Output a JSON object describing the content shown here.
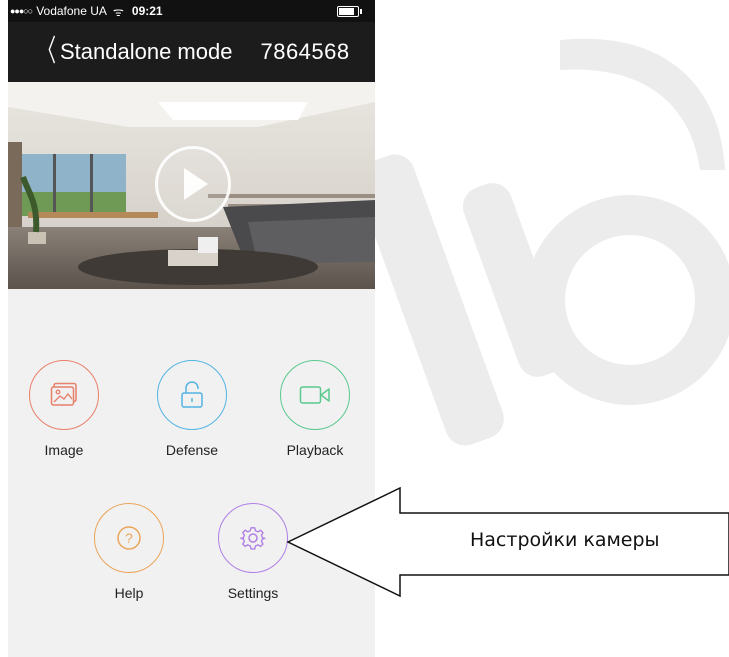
{
  "status_bar": {
    "signal": "●●●○○",
    "carrier": "Vodafone UA",
    "wifi": "ᯤ",
    "time": "09:21",
    "battery_level": 0.85
  },
  "nav": {
    "back_icon": "chevron-left",
    "back_glyph": "〈",
    "title": "Standalone mode",
    "device_id": "7864568"
  },
  "preview": {
    "play_icon": "play-icon"
  },
  "menu": {
    "row1": [
      {
        "label": "Image",
        "icon": "image-icon",
        "color": "#e8806a"
      },
      {
        "label": "Defense",
        "icon": "lock-icon",
        "color": "#53b4e3"
      },
      {
        "label": "Playback",
        "icon": "video-camera-icon",
        "color": "#5bc98f"
      }
    ],
    "row2": [
      {
        "label": "Help",
        "icon": "question-icon",
        "color": "#eaa55a"
      },
      {
        "label": "Settings",
        "icon": "gear-icon",
        "color": "#b07fe6"
      }
    ]
  },
  "callout": {
    "text": "Настройки камеры"
  }
}
